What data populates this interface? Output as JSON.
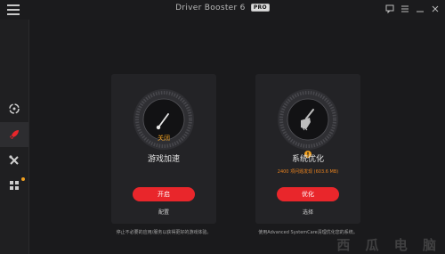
{
  "titlebar": {
    "title": "Driver Booster 6",
    "pro_badge": "PRO",
    "controls": [
      "feedback-icon",
      "menu-lines-icon",
      "minimize-icon",
      "close-icon"
    ]
  },
  "sidebar": {
    "items": [
      {
        "icon": "scan-refresh-icon",
        "active": false
      },
      {
        "icon": "rocket-icon",
        "active": true,
        "color": "#e9262b"
      },
      {
        "icon": "tools-icon",
        "active": false
      },
      {
        "icon": "grid-apps-icon",
        "active": false,
        "notification": true
      }
    ]
  },
  "cards": [
    {
      "status": "关闭",
      "title": "游戏加速",
      "button": "开启",
      "link": "配置",
      "description": "停止不必要的应用/服务以获得更好的游戏体验。"
    },
    {
      "status_icon": "warning-icon",
      "title": "系统优化",
      "subtitle": "2400 项问题发现 (603.6 MB)",
      "button": "优化",
      "link": "选择",
      "description": "使用Advanced SystemCare清理优化您的系统。"
    }
  ],
  "watermark": "西 瓜 电 脑",
  "colors": {
    "accent": "#e9262b",
    "warning": "#f0a020",
    "background": "#1a1a1c"
  }
}
